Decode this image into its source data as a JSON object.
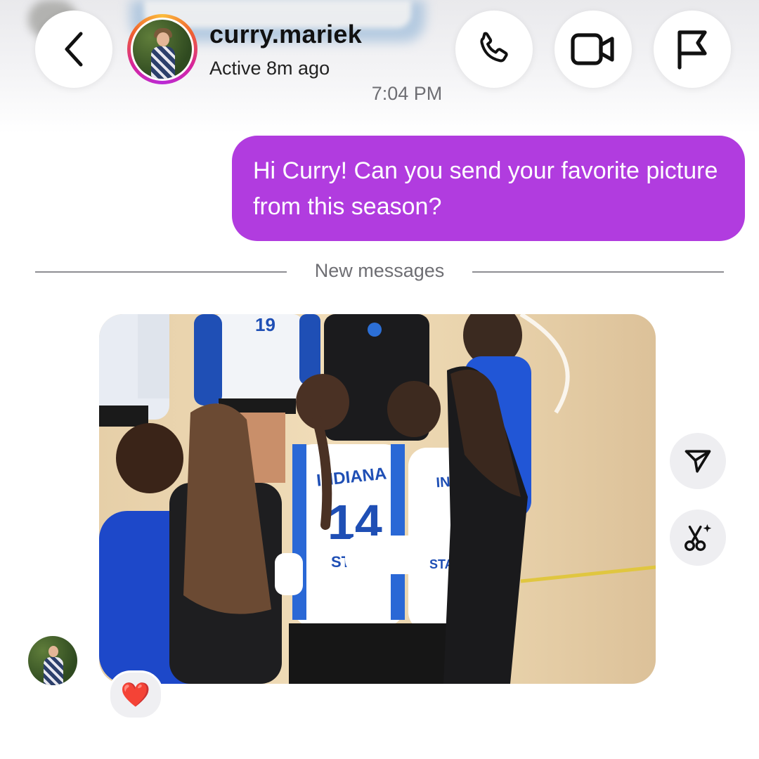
{
  "header": {
    "username": "curry.mariek",
    "status": "Active 8m ago",
    "back_icon": "chevron-left-icon",
    "call_icon": "phone-icon",
    "video_icon": "video-camera-icon",
    "report_icon": "flag-icon"
  },
  "chat": {
    "timestamp": "7:04 PM",
    "outgoing_message": "Hi Curry! Can you send your favorite picture from this season?",
    "divider_label": "New messages",
    "photo": {
      "jersey_numbers": [
        "19",
        "14"
      ],
      "jersey_text": [
        "INDIANA",
        "STATE"
      ]
    },
    "reaction": "❤️",
    "side_actions": [
      "send-icon",
      "sparkle-scissors-icon"
    ]
  },
  "colors": {
    "outgoing_bubble": "#b13cdf",
    "secondary_text": "#6e6e73",
    "jersey_blue": "#1f4fb5"
  }
}
